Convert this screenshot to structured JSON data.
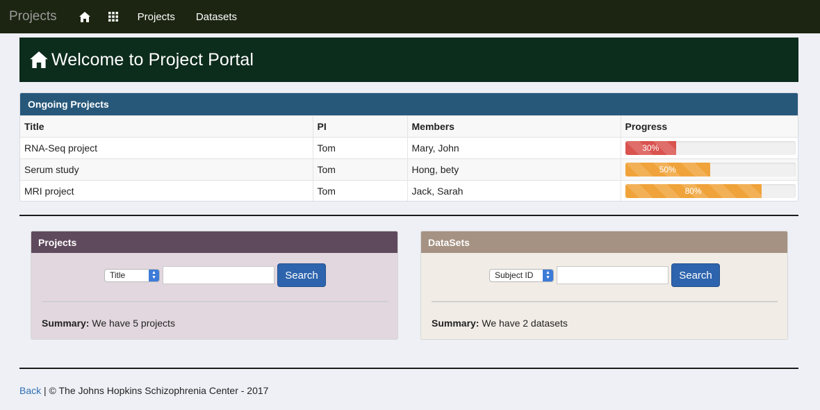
{
  "navbar": {
    "brand": "Projects",
    "home_icon": "home-icon",
    "apps_icon": "grid-icon",
    "links": [
      "Projects",
      "Datasets"
    ]
  },
  "banner": {
    "icon": "home-icon",
    "title": "Welcome to Project Portal"
  },
  "ongoing": {
    "heading": "Ongoing Projects",
    "columns": [
      "Title",
      "PI",
      "Members",
      "Progress"
    ],
    "rows": [
      {
        "title": "RNA-Seq project",
        "pi": "Tom",
        "members": "Mary, John",
        "progress": 30,
        "progress_label": "30%",
        "color": "#d9534f"
      },
      {
        "title": "Serum study",
        "pi": "Tom",
        "members": "Hong, bety",
        "progress": 50,
        "progress_label": "50%",
        "color": "#f0a33a"
      },
      {
        "title": "MRI project",
        "pi": "Tom",
        "members": "Jack, Sarah",
        "progress": 80,
        "progress_label": "80%",
        "color": "#f0a33a"
      }
    ]
  },
  "projects_panel": {
    "heading": "Projects",
    "select_value": "Title",
    "input_value": "",
    "button": "Search",
    "summary_label": "Summary:",
    "summary_text": " We have 5 projects"
  },
  "datasets_panel": {
    "heading": "DataSets",
    "select_value": "Subject ID",
    "input_value": "",
    "button": "Search",
    "summary_label": "Summary:",
    "summary_text": " We have 2 datasets"
  },
  "footer": {
    "back_link": "Back",
    "copyright": " | © The Johns Hopkins Schizophrenia Center - 2017"
  },
  "colors": {
    "navbar": "#1b2511",
    "banner": "#0c2c1c",
    "ongoing_header": "#27587a",
    "projects_header": "#5f4a5d",
    "datasets_header": "#a59283",
    "button": "#2d64ad",
    "link": "#2f6fb0"
  }
}
